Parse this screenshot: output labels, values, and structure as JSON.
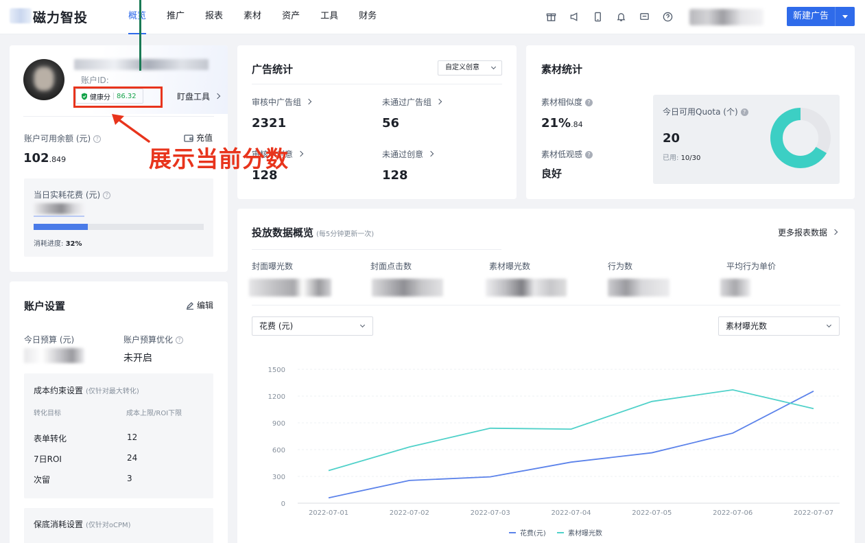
{
  "app": {
    "name": "磁力智投"
  },
  "nav": [
    {
      "label": "概览",
      "active": true
    },
    {
      "label": "推广",
      "active": false
    },
    {
      "label": "报表",
      "active": false
    },
    {
      "label": "素材",
      "active": false
    },
    {
      "label": "资产",
      "active": false
    },
    {
      "label": "工具",
      "active": false
    },
    {
      "label": "财务",
      "active": false
    }
  ],
  "header_icons": [
    "gift-icon",
    "megaphone-icon",
    "mobile-icon",
    "bell-icon",
    "message-icon",
    "help-icon"
  ],
  "new_ad_button": "新建广告",
  "account": {
    "id_label": "账户ID:",
    "health_label": "健康分",
    "health_score": "86.32",
    "tool_link": "盯盘工具",
    "balance_label": "账户可用余额 (元)",
    "recharge": "充值",
    "balance_int": "102",
    "balance_dec": ".849",
    "daily_spend_label": "当日实耗花费 (元)",
    "progress_label": "消耗进度:",
    "progress_percent": "32%",
    "progress_value": 0.32
  },
  "settings": {
    "title": "账户设置",
    "edit": "编辑",
    "budget_label": "今日预算 (元)",
    "budget_opt_label": "账户预算优化",
    "budget_opt_value": "未开启",
    "cost_title": "成本约束设置",
    "cost_note": "(仅针对最大转化)",
    "col_target": "转化目标",
    "col_limit": "成本上限/ROI下限",
    "rows": [
      {
        "target": "表单转化",
        "value": "12"
      },
      {
        "target": "7日ROI",
        "value": "24"
      },
      {
        "target": "次留",
        "value": "3"
      }
    ],
    "floor_title": "保底消耗设置",
    "floor_note": "(仅针对oCPM)"
  },
  "ad_stats": {
    "title": "广告统计",
    "selector": "自定义创意",
    "items": [
      {
        "label": "审核中广告组",
        "value": "2321"
      },
      {
        "label": "未通过广告组",
        "value": "56"
      },
      {
        "label": "审核中创意",
        "value": "128"
      },
      {
        "label": "未通过创意",
        "value": "128"
      }
    ]
  },
  "material_stats": {
    "title": "素材统计",
    "similarity_label": "素材相似度",
    "similarity_int": "21%",
    "similarity_dec": ".84",
    "low_quality_label": "素材低观感",
    "low_quality_value": "良好",
    "quota_label": "今日可用Quota (个)",
    "quota_value": "20",
    "used_label": "已用:",
    "used_value": "10/30",
    "used_fraction": 0.333,
    "colors": {
      "ring": "#3ccfc4",
      "track": "#e5e6ea"
    }
  },
  "overview": {
    "title": "投放数据概览",
    "note": "(每5分钟更新一次)",
    "more": "更多报表数据",
    "kpis": [
      "封面曝光数",
      "封面点击数",
      "素材曝光数",
      "行为数",
      "平均行为单价"
    ],
    "left_metric": "花费 (元)",
    "right_metric": "素材曝光数"
  },
  "annotation": {
    "text": "展示当前分数"
  },
  "chart_data": {
    "type": "line",
    "x": [
      "2022-07-01",
      "2022-07-02",
      "2022-07-03",
      "2022-07-04",
      "2022-07-05",
      "2022-07-06",
      "2022-07-07"
    ],
    "y_ticks": [
      0,
      300,
      600,
      900,
      1200,
      1500
    ],
    "ylim": [
      0,
      1500
    ],
    "grid": true,
    "legend_position": "bottom",
    "series": [
      {
        "name": "花费(元)",
        "color": "#5b82ea",
        "values": [
          60,
          255,
          295,
          460,
          565,
          785,
          1255
        ]
      },
      {
        "name": "素材曝光数",
        "color": "#4fd1c9",
        "values": [
          365,
          630,
          840,
          830,
          1140,
          1270,
          1060
        ]
      }
    ]
  }
}
